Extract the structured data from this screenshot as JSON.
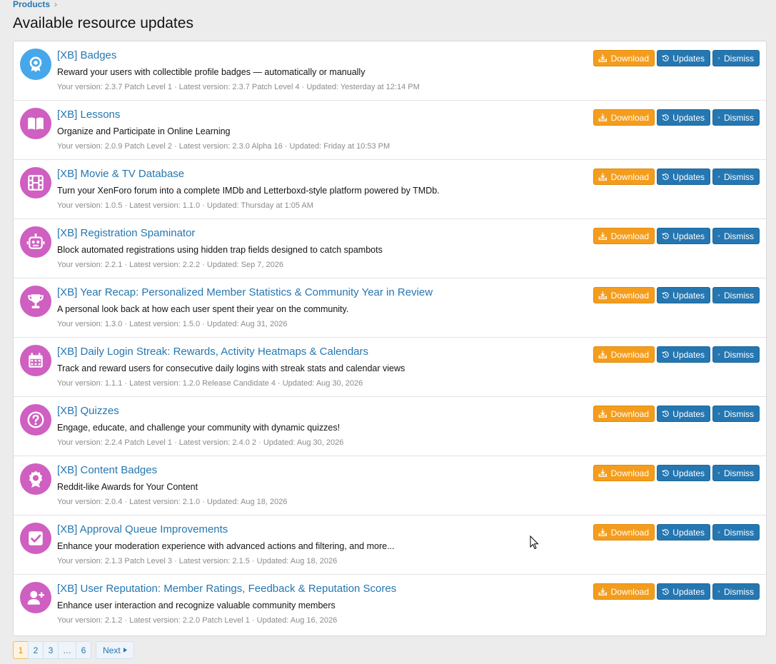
{
  "breadcrumb": {
    "item": "Products",
    "separator": "›"
  },
  "page_title": "Available resource updates",
  "buttons": {
    "download": "Download",
    "updates": "Updates",
    "dismiss": "Dismiss"
  },
  "colors": {
    "accent": "#2577b1",
    "download": "#f49d1d",
    "avatar_blue": "#47a7eb",
    "avatar_purple": "#cf5fc0"
  },
  "items": [
    {
      "title": "[XB] Badges",
      "description": "Reward your users with collectible profile badges — automatically or manually",
      "meta": "Your version: 2.3.7 Patch Level 1 · Latest version: 2.3.7 Patch Level 4 · Updated: Yesterday at 12:14 PM",
      "icon": "badge-icon",
      "color": "#47a7eb"
    },
    {
      "title": "[XB] Lessons",
      "description": "Organize and Participate in Online Learning",
      "meta": "Your version: 2.0.9 Patch Level 2 · Latest version: 2.3.0 Alpha 16 · Updated: Friday at 10:53 PM",
      "icon": "book-icon",
      "color": "#cf5fc0"
    },
    {
      "title": "[XB] Movie & TV Database",
      "description": "Turn your XenForo forum into a complete IMDb and Letterboxd-style platform powered by TMDb.",
      "meta": "Your version: 1.0.5 · Latest version: 1.1.0 · Updated: Thursday at 1:05 AM",
      "icon": "film-icon",
      "color": "#cf5fc0"
    },
    {
      "title": "[XB] Registration Spaminator",
      "description": "Block automated registrations using hidden trap fields designed to catch spambots",
      "meta": "Your version: 2.2.1 · Latest version: 2.2.2 · Updated: Sep 7, 2026",
      "icon": "robot-icon",
      "color": "#cf5fc0"
    },
    {
      "title": "[XB] Year Recap: Personalized Member Statistics & Community Year in Review",
      "description": "A personal look back at how each user spent their year on the community.",
      "meta": "Your version: 1.3.0 · Latest version: 1.5.0 · Updated: Aug 31, 2026",
      "icon": "trophy-icon",
      "color": "#cf5fc0"
    },
    {
      "title": "[XB] Daily Login Streak: Rewards, Activity Heatmaps & Calendars",
      "description": "Track and reward users for consecutive daily logins with streak stats and calendar views",
      "meta": "Your version: 1.1.1 · Latest version: 1.2.0 Release Candidate 4 · Updated: Aug 30, 2026",
      "icon": "calendar-icon",
      "color": "#cf5fc0"
    },
    {
      "title": "[XB] Quizzes",
      "description": "Engage, educate, and challenge your community with dynamic quizzes!",
      "meta": "Your version: 2.2.4 Patch Level 1 · Latest version: 2.4.0 2 · Updated: Aug 30, 2026",
      "icon": "question-icon",
      "color": "#cf5fc0"
    },
    {
      "title": "[XB] Content Badges",
      "description": "Reddit-like Awards for Your Content",
      "meta": "Your version: 2.0.4 · Latest version: 2.1.0 · Updated: Aug 18, 2026",
      "icon": "award-icon",
      "color": "#cf5fc0"
    },
    {
      "title": "[XB] Approval Queue Improvements",
      "description": "Enhance your moderation experience with advanced actions and filtering, and more...",
      "meta": "Your version: 2.1.3 Patch Level 3 · Latest version: 2.1.5 · Updated: Aug 18, 2026",
      "icon": "checkbox-icon",
      "color": "#cf5fc0"
    },
    {
      "title": "[XB] User Reputation: Member Ratings, Feedback & Reputation Scores",
      "description": "Enhance user interaction and recognize valuable community members",
      "meta": "Your version: 2.1.2 · Latest version: 2.2.0 Patch Level 1 · Updated: Aug 16, 2026",
      "icon": "user-plus-icon",
      "color": "#cf5fc0"
    }
  ],
  "pagination": {
    "pages": [
      "1",
      "2",
      "3",
      "…",
      "6"
    ],
    "current": "1",
    "next": "Next"
  }
}
